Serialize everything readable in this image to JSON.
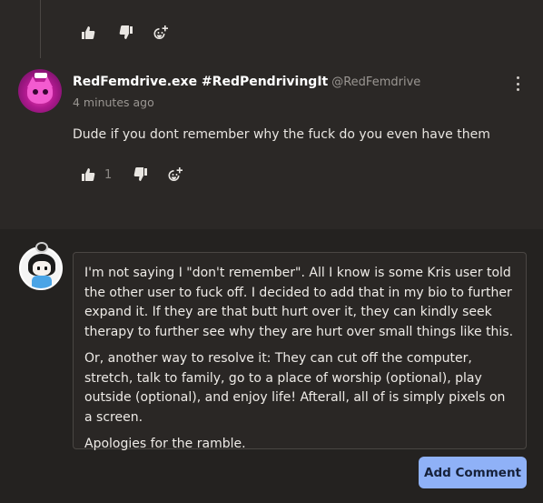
{
  "previous_comment": {
    "partial_text": "",
    "actions": {
      "like_icon": "thumbs-up-icon",
      "dislike_icon": "thumbs-down-icon",
      "react_icon": "add-reaction-icon"
    }
  },
  "comment": {
    "author": "RedFemdrive.exe #RedPendrivingIt",
    "handle": "@RedFemdrive",
    "time": "4 minutes ago",
    "body": "Dude if you dont remember why the fuck do you even have them",
    "like_count": "1"
  },
  "reply_editor": {
    "paragraphs": [
      "I'm not saying I \"don't remember\". All I know is some Kris user told the other user to fuck off. I decided to add that in my bio to further expand it. If they are that butt hurt over it, they can kindly seek therapy to further see why they are hurt over small things like this.",
      "Or, another way to resolve it: They can cut off the computer, stretch, talk to family, go to a place of worship (optional), play outside (optional), and enjoy life! Afterall, all of is simply pixels on a screen.",
      "Apologies for the ramble."
    ]
  },
  "add_comment_label": "Add Comment",
  "colors": {
    "accent_button": "#8fb1f7",
    "background_top": "#2b2826",
    "background_bottom": "#242220"
  }
}
